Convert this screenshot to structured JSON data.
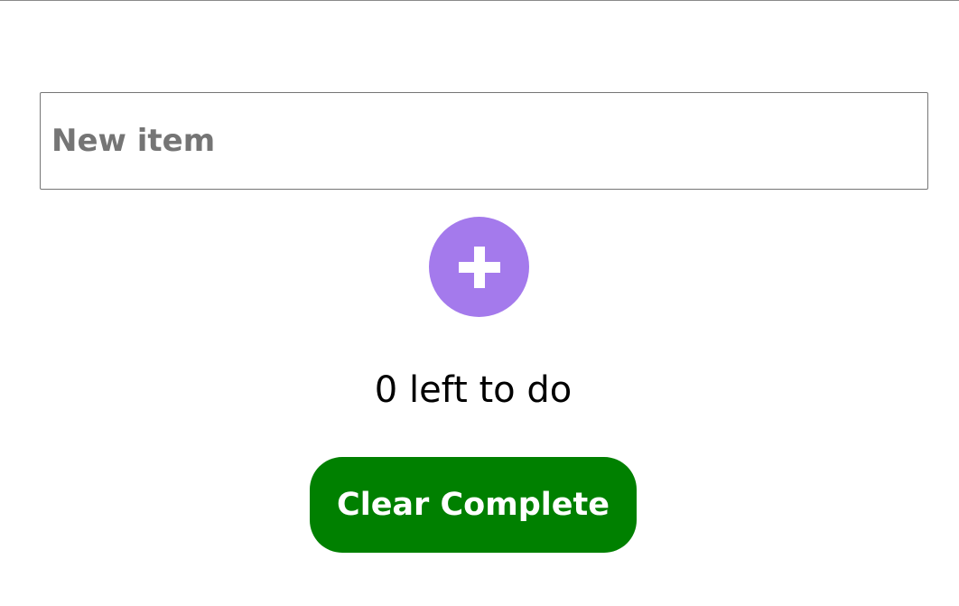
{
  "new_item": {
    "placeholder": "New item",
    "value": ""
  },
  "add_button": {
    "icon": "plus-icon",
    "color": "#a47aec"
  },
  "status": {
    "left_to_do": "0 left to do"
  },
  "clear_button": {
    "label": "Clear Complete",
    "color": "#008000"
  }
}
